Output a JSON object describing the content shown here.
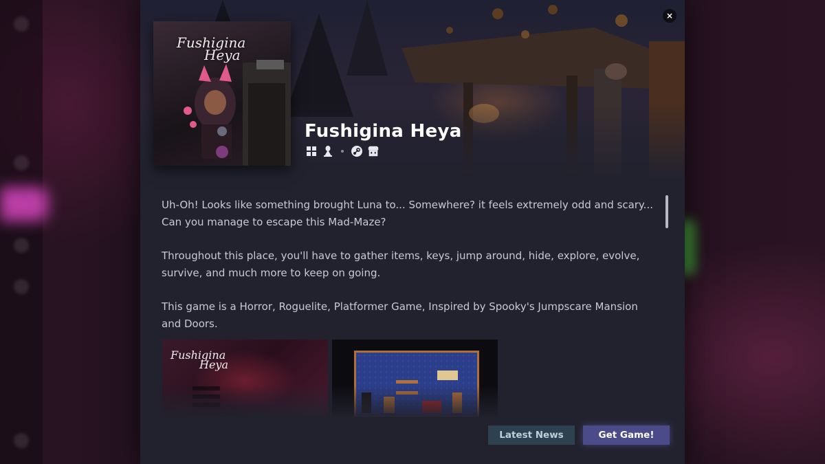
{
  "game": {
    "title": "Fushigina Heya",
    "cover_logo_line1": "Fushigina",
    "cover_logo_line2": "Heya",
    "platforms": [
      "windows-icon",
      "linux-icon",
      "steam-icon",
      "itch-io-icon"
    ]
  },
  "description": [
    "Uh-Oh! Looks like something brought Luna to... Somewhere? it feels extremely odd and scary... Can you manage to escape this Mad-Maze?",
    "Throughout this place, you'll have to gather items, keys, jump around, hide, explore, evolve, survive, and much more to keep on going.",
    "This game is a Horror, Roguelite, Platformer Game, Inspired by Spooky's Jumpscare Mansion and Doors."
  ],
  "screenshots": {
    "shot1_logo_line1": "Fushigina",
    "shot1_logo_line2": "Heya"
  },
  "actions": {
    "close": "×",
    "latest_news": "Latest News",
    "get_game": "Get Game!"
  },
  "colors": {
    "modal_bg": "#22222f",
    "news_button": "#2d4150",
    "get_button": "#4b4b8a",
    "accent_pink": "#d746be"
  }
}
